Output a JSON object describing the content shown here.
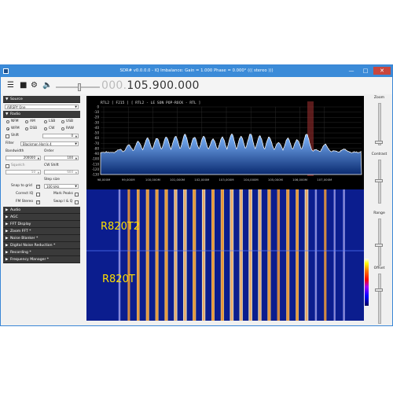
{
  "window": {
    "title": "SDR# v0.0.0.0 - IQ Imbalance: Gain = 1.000 Phase = 0.000° ((( stereo )))"
  },
  "toolbar": {
    "frequency_dim": "000.",
    "frequency_main": "105.900.000"
  },
  "source": {
    "header": "Source",
    "device": "AIRSPY One"
  },
  "radio": {
    "header": "Radio",
    "modes": [
      "NFM",
      "AM",
      "LSB",
      "USB",
      "WFM",
      "DSB",
      "CW",
      "RAW"
    ],
    "selected_mode": "WFM",
    "shift_label": "Shift",
    "shift_value": "0",
    "filter_label": "Filter",
    "filter_value": "Blackman Harris 4",
    "bandwidth_label": "Bandwidth",
    "bandwidth_value": "200000",
    "order_label": "Order",
    "order_value": "100",
    "squelch_label": "Squelch",
    "cw_shift_label": "CW Shift",
    "squelch_value": "50",
    "cw_shift_value": "600",
    "step_size_label": "Step size",
    "snap_label": "Snap to grid",
    "step_value": "100 kHz",
    "correct_iq_label": "Correct IQ",
    "mark_peaks_label": "Mark Peaks",
    "fm_stereo_label": "FM Stereo",
    "swap_iq_label": "Swap I & Q"
  },
  "sections": [
    "Audio",
    "AGC",
    "FFT Display",
    "Zoom FFT *",
    "Noise Blanker *",
    "Digital Noise Reduction *",
    "Recording *",
    "Frequency Manager *"
  ],
  "spectrum": {
    "rds_text": "RTL2    [ F215 ]   [ RTL2 - LE SON POP-ROCK - RTL ]",
    "y_ticks": [
      "0",
      "-10",
      "-20",
      "-30",
      "-40",
      "-50",
      "-60",
      "-70",
      "-80",
      "-90",
      "-100",
      "-110",
      "-120",
      "-130"
    ],
    "x_ticks": [
      "98,000M",
      "99,000M",
      "100,000M",
      "101,000M",
      "102,000M",
      "103,000M",
      "104,000M",
      "105,000M",
      "106,000M",
      "107,000M"
    ],
    "peaks": [
      -82,
      -73,
      -66,
      -60,
      -60,
      -58,
      -57,
      -53,
      -58,
      -57,
      -62,
      -58,
      -52,
      -57,
      -52,
      -56,
      -58,
      -68,
      -60,
      -63,
      -52,
      -82,
      -72,
      -84,
      -81
    ]
  },
  "waterfall": {
    "label_top": "R820T2",
    "label_bottom": "R820T"
  },
  "rightpanel": {
    "zoom_label": "Zoom",
    "contrast_label": "Contrast",
    "range_label": "Range",
    "offset_label": "Offset"
  }
}
